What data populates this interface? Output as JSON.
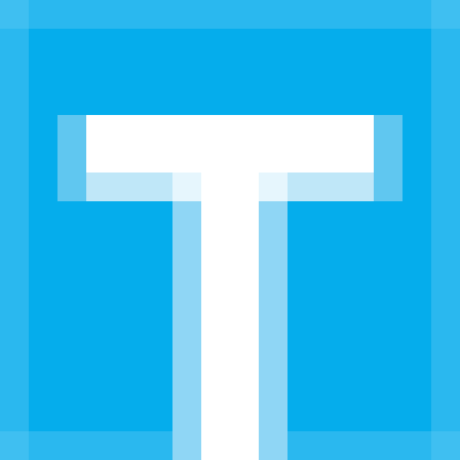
{
  "logo": {
    "letter": "T",
    "colors": {
      "background": "#05adec",
      "border": "#2ab8ef",
      "corner": "#3fbff1",
      "halo_outer": "#60c7f0",
      "halo_bar": "#bfe7f8",
      "halo_stem": "#8fd6f5",
      "halo_center": "#e6f6fd",
      "glyph": "#ffffff"
    }
  }
}
